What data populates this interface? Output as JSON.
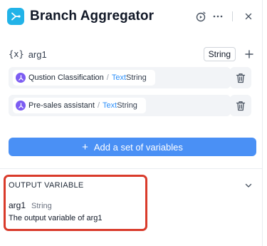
{
  "header": {
    "title": "Branch Aggregator",
    "icon": "branch-merge-icon",
    "actions": [
      "run-step-icon",
      "more-icon",
      "close-icon"
    ],
    "accent": "#22b3e8"
  },
  "variable": {
    "prefix": "{x}",
    "name": "arg1",
    "type": "String",
    "add_icon": "plus-icon"
  },
  "items": [
    {
      "label": "Qustion Classification",
      "slash": "/",
      "type_a": "Text",
      "type_b": "String"
    },
    {
      "label": "Pre-sales assistant",
      "slash": "/",
      "type_a": "Text",
      "type_b": "String"
    }
  ],
  "add_button": {
    "label": "Add a set of variables",
    "color": "#4a90f5"
  },
  "output": {
    "header": "OUTPUT VARIABLE",
    "name": "arg1",
    "type": "String",
    "description": "The output variable of arg1",
    "highlight_color": "#d93b2b"
  }
}
